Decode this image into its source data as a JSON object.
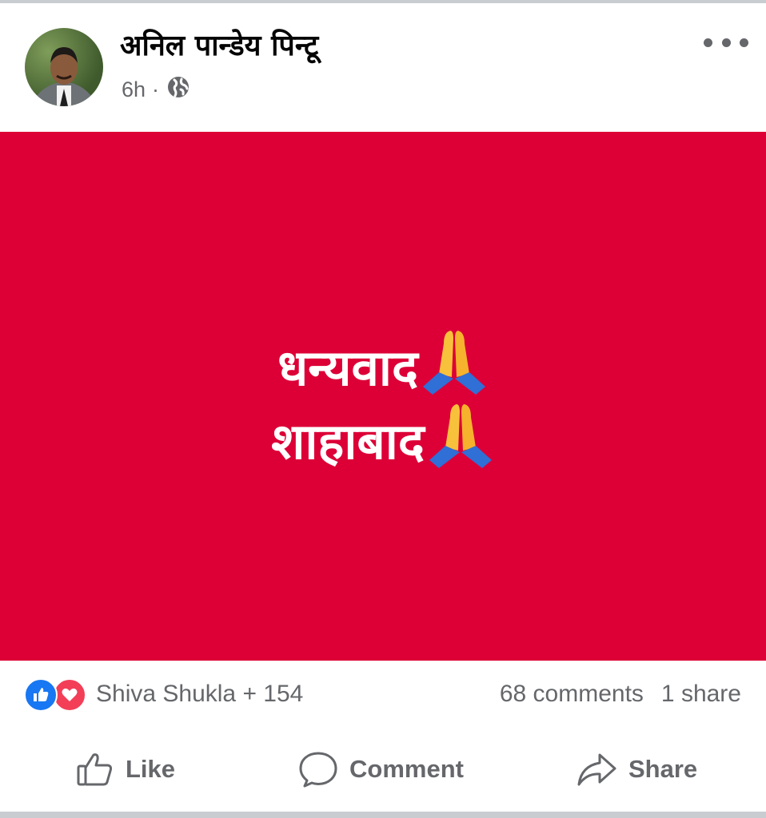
{
  "post": {
    "author": "अनिल पान्डेय पिन्टू",
    "time": "6h",
    "separator": "·",
    "privacy_icon": "globe-icon",
    "menu_icon": "more-options-icon"
  },
  "image": {
    "background": "#dc0037",
    "line1": "धन्यवाद",
    "line2": "शाहाबाद",
    "emoji_icon": "folded-hands-icon"
  },
  "reactions": {
    "names": "Shiva Shukla + 154",
    "comments": "68 comments",
    "shares": "1 share",
    "icons": [
      "like-reaction-icon",
      "love-reaction-icon"
    ]
  },
  "actions": {
    "like_label": "Like",
    "comment_label": "Comment",
    "share_label": "Share"
  },
  "colors": {
    "like_blue": "#1877f2",
    "love_red": "#f33e58",
    "secondary_text": "#65676b"
  }
}
